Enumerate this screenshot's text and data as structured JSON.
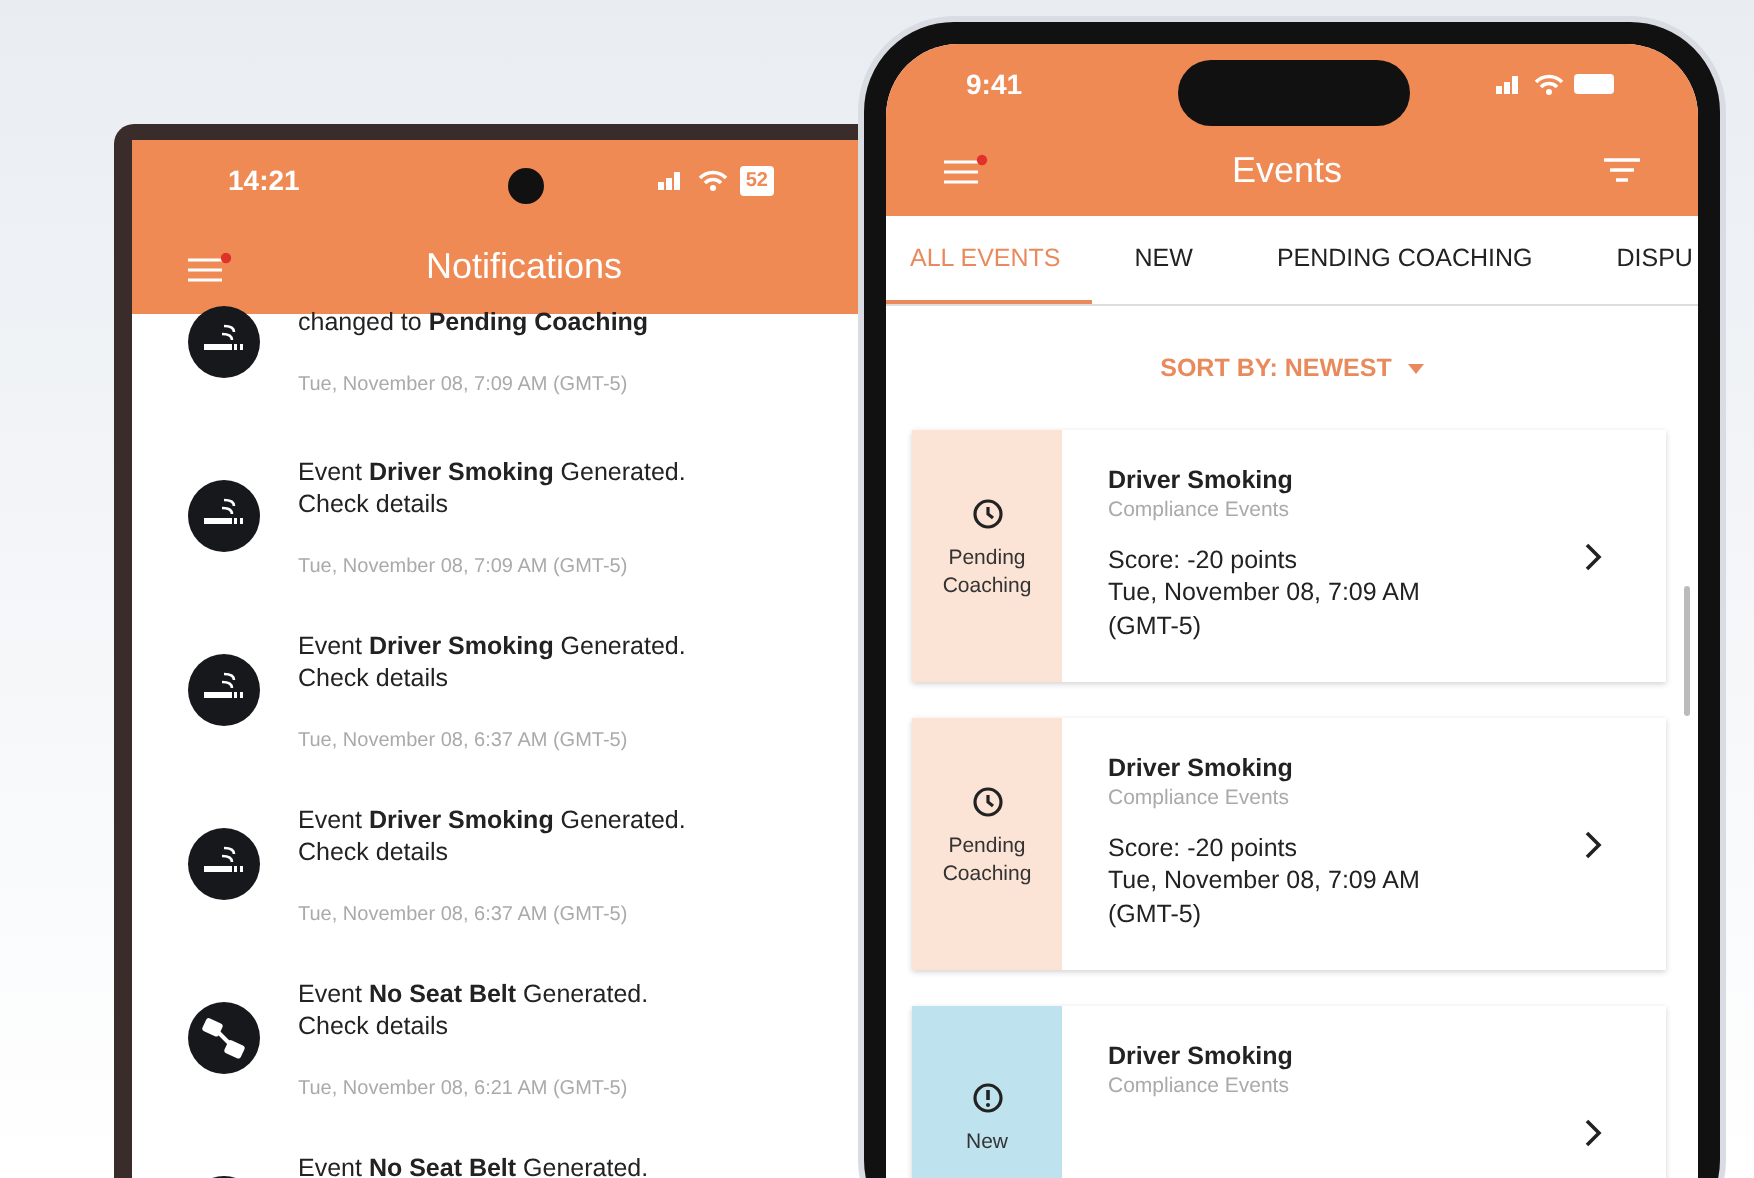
{
  "notifications_phone": {
    "status_bar": {
      "time": "14:21",
      "battery": "52"
    },
    "title": "Notifications",
    "menu_badge": true,
    "items": [
      {
        "kind": "smoking",
        "text": "changed to **Pending Coaching**",
        "date": "Tue, November 08, 7:09 AM (GMT-5)"
      },
      {
        "kind": "smoking",
        "text": "Event **Driver Smoking** Generated. Check details",
        "date": "Tue, November 08, 7:09 AM (GMT-5)"
      },
      {
        "kind": "smoking",
        "text": "Event **Driver Smoking** Generated. Check details",
        "date": "Tue, November 08, 6:37 AM (GMT-5)"
      },
      {
        "kind": "smoking",
        "text": "Event **Driver Smoking** Generated. Check details",
        "date": "Tue, November 08, 6:37 AM (GMT-5)"
      },
      {
        "kind": "seatbelt",
        "text": "Event **No Seat Belt** Generated. Check details",
        "date": "Tue, November 08, 6:21 AM (GMT-5)"
      },
      {
        "kind": "seatbelt",
        "text": "Event **No Seat Belt** Generated."
      }
    ]
  },
  "events_phone": {
    "status_bar": {
      "time": "9:41"
    },
    "title": "Events",
    "menu_badge": true,
    "tabs": [
      {
        "label": "ALL EVENTS",
        "selected": true
      },
      {
        "label": "NEW",
        "selected": false
      },
      {
        "label": "PENDING COACHING",
        "selected": false
      },
      {
        "label": "DISPU",
        "selected": false
      }
    ],
    "sort": "SORT BY: NEWEST",
    "events": [
      {
        "kind": "pending",
        "status": "Pending Coaching",
        "title": "Driver Smoking",
        "category": "Compliance Events",
        "score": "Score: -20 points",
        "date": "Tue, November 08, 7:09 AM (GMT-5)"
      },
      {
        "kind": "pending",
        "status": "Pending Coaching",
        "title": "Driver Smoking",
        "category": "Compliance Events",
        "score": "Score: -20 points",
        "date": "Tue, November 08, 7:09 AM (GMT-5)"
      },
      {
        "kind": "new",
        "status": "New",
        "title": "Driver Smoking",
        "category": "Compliance Events"
      }
    ]
  }
}
